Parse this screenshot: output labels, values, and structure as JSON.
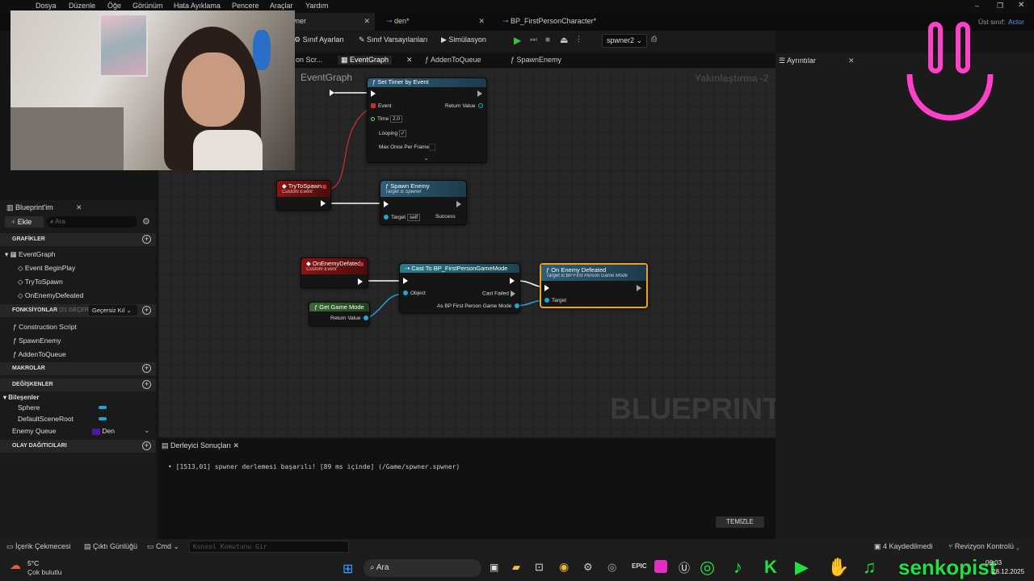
{
  "menu": [
    "Dosya",
    "Düzenle",
    "Öğe",
    "Görünüm",
    "Hata Ayıklama",
    "Pencere",
    "Araçlar",
    "Yardım"
  ],
  "tabs": [
    {
      "label": "spwner"
    },
    {
      "label": "den*"
    },
    {
      "label": "BP_FirstPersonCharacter*"
    }
  ],
  "parent_class": {
    "label": "Üst sınıf:",
    "value": "Actor"
  },
  "toolbar": {
    "class_settings": "Sınıf Ayarları",
    "class_defaults": "Sınıf Varsayılanları",
    "simulation": "Simülasyon",
    "debug_object": "spwner2"
  },
  "graph_tabs": [
    "on Scr...",
    "EventGraph",
    "AddenToQueue",
    "SpawnEnemy"
  ],
  "graph": {
    "title": "EventGraph",
    "zoom": "Yakınlaştırma -2",
    "watermark": "BLUEPRINT"
  },
  "nodes": {
    "set_timer": {
      "title": "Set Timer by Event",
      "event": "Event",
      "return_value": "Return Value",
      "time_label": "Time",
      "time_value": "2.0",
      "looping": "Looping",
      "max_once": "Max Once Per Frame",
      "looping_check": "✓"
    },
    "try_to_spawn": {
      "title": "TryToSpawn",
      "sub": "Custom Event"
    },
    "spawn_enemy": {
      "title": "Spawn Enemy",
      "sub": "Target is Spwner",
      "target": "Target",
      "target_value": "self",
      "success": "Success"
    },
    "on_enemy_defated": {
      "title": "OnEnemyDefated",
      "sub": "Custom Event"
    },
    "cast": {
      "title": "Cast To BP_FirstPersonGameMode",
      "object": "Object",
      "cast_failed": "Cast Failed",
      "as": "As BP First Person Game Mode"
    },
    "on_enemy_defeated": {
      "title": "On Enemy Defeated",
      "sub": "Target is BP First Person Game Mode",
      "target": "Target"
    },
    "get_game_mode": {
      "title": "Get Game Mode",
      "return_value": "Return Value"
    }
  },
  "myblueprint": {
    "title": "Blueprint'im",
    "add": "Ekle",
    "search_placeholder": "Ara",
    "graphs_header": "GRAFİKLER",
    "event_graph": "EventGraph",
    "events": [
      "Event BeginPlay",
      "TryToSpawn",
      "OnEnemyDefeated"
    ],
    "functions_header": "FONKSİYONLAR",
    "functions_count": "(21 GEÇERSİZ",
    "override": "Geçersiz Kıl",
    "functions": [
      "Construction Script",
      "SpawnEnemy",
      "AddenToQueue"
    ],
    "macros_header": "MAKROLAR",
    "variables_header": "DEĞİŞKENLER",
    "components": "Bileşenler",
    "component_items": [
      "Sphere",
      "DefaultSceneRoot"
    ],
    "enemy_queue": "Enemy Queue",
    "enemy_queue_type": "Den",
    "dispatchers_header": "OLAY DAĞITICILARI"
  },
  "details": {
    "title": "Ayrıntılar"
  },
  "compiler": {
    "title": "Derleyici Sonuçları",
    "message": "[1513,01] spwner derlemesi başarılı! [89 ms içinde] (/Game/spwner.spwner)",
    "clear": "TEMİZLE"
  },
  "statusbar": {
    "content_drawer": "İçerik Çekmecesi",
    "output_log": "Çıktı Günlüğü",
    "cmd": "Cmd",
    "console_placeholder": "Konsol Komutunu Gir",
    "saved": "4 Kaydedilmedi",
    "revision": "Revizyon Kontrolü"
  },
  "taskbar": {
    "temp": "5°C",
    "weather": "Çok bulutlu",
    "search": "Ara",
    "time": "06:03",
    "date": "28.12.2025"
  },
  "overlay": {
    "brand": "senkopist"
  },
  "colors": {
    "event_red": "#8a1414",
    "function_blue": "#2f5f7a",
    "pure_green": "#3a6b33",
    "selected": "#f0a020",
    "exec_wire": "#ffffff",
    "object_wire": "#1ea6d8",
    "delegate_wire": "#c03030"
  }
}
